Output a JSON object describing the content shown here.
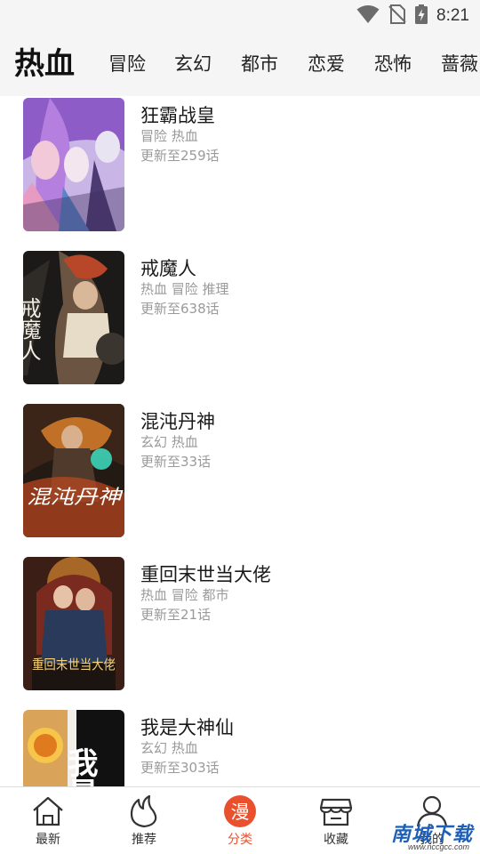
{
  "status_bar": {
    "time": "8:21",
    "icons": [
      "wifi-icon",
      "no-sim-icon",
      "battery-charging-icon"
    ]
  },
  "categories": {
    "active": "热血",
    "tabs": [
      "冒险",
      "玄幻",
      "都市",
      "恋爱",
      "恐怖",
      "蔷薇"
    ]
  },
  "comics": [
    {
      "title": "狂霸战皇",
      "tags": "冒险 热血",
      "update": "更新至259话"
    },
    {
      "title": "戒魔人",
      "tags": "热血 冒险 推理",
      "update": "更新至638话"
    },
    {
      "title": "混沌丹神",
      "tags": "玄幻 热血",
      "update": "更新至33话"
    },
    {
      "title": "重回末世当大佬",
      "tags": "热血 冒险 都市",
      "update": "更新至21话"
    },
    {
      "title": "我是大神仙",
      "tags": "玄幻 热血",
      "update": "更新至303话"
    }
  ],
  "cover_art_text": {
    "c2": "戒魔人",
    "c3": "混沌丹神",
    "c4": "重回末世当大佬",
    "c5": "我是大神"
  },
  "bottom_nav": {
    "items": [
      {
        "label": "最新",
        "icon": "home-icon"
      },
      {
        "label": "推荐",
        "icon": "flame-icon"
      },
      {
        "label": "分类",
        "icon": "manga-category-icon",
        "icon_char": "漫"
      },
      {
        "label": "收藏",
        "icon": "store-icon"
      },
      {
        "label": "我的",
        "icon": "user-icon"
      }
    ],
    "active_index": 2
  },
  "watermark": {
    "main": "南城下载",
    "sub": "www.nccgcc.com"
  },
  "colors": {
    "accent": "#e8502e",
    "text_primary": "#1a1a1a",
    "text_secondary": "#9a9a9a",
    "header_bg": "#f5f5f5"
  }
}
